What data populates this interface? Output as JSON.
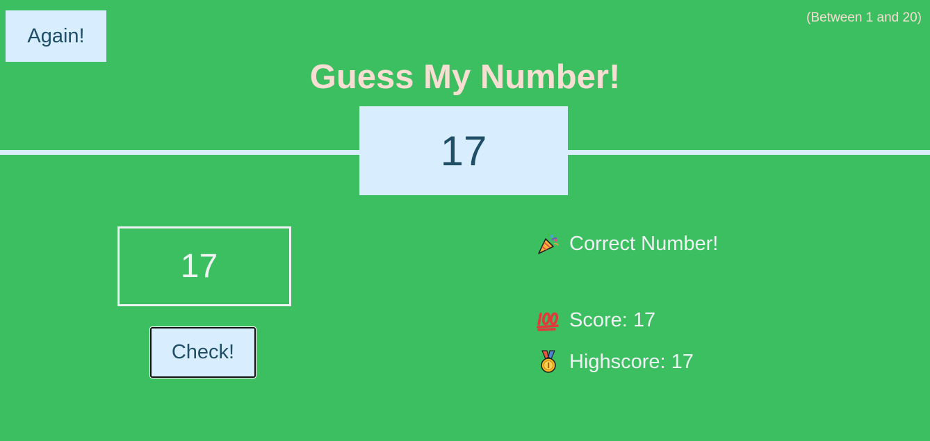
{
  "header": {
    "again_label": "Again!",
    "range_hint": "(Between 1 and 20)",
    "title": "Guess My Number!"
  },
  "secret_number": "17",
  "guess": {
    "value": "17"
  },
  "check_label": "Check!",
  "message": "Correct Number!",
  "score_text": "Score: 17",
  "highscore_text": "Highscore: 17",
  "icons": {
    "message": "party-popper-icon",
    "score": "hundred-points-icon",
    "highscore": "medal-icon"
  },
  "colors": {
    "background": "#3cbf60",
    "panel": "#d8eefe",
    "title": "#f8ddd2",
    "dark_text": "#1f4e66",
    "light_text": "#eef2f3"
  }
}
